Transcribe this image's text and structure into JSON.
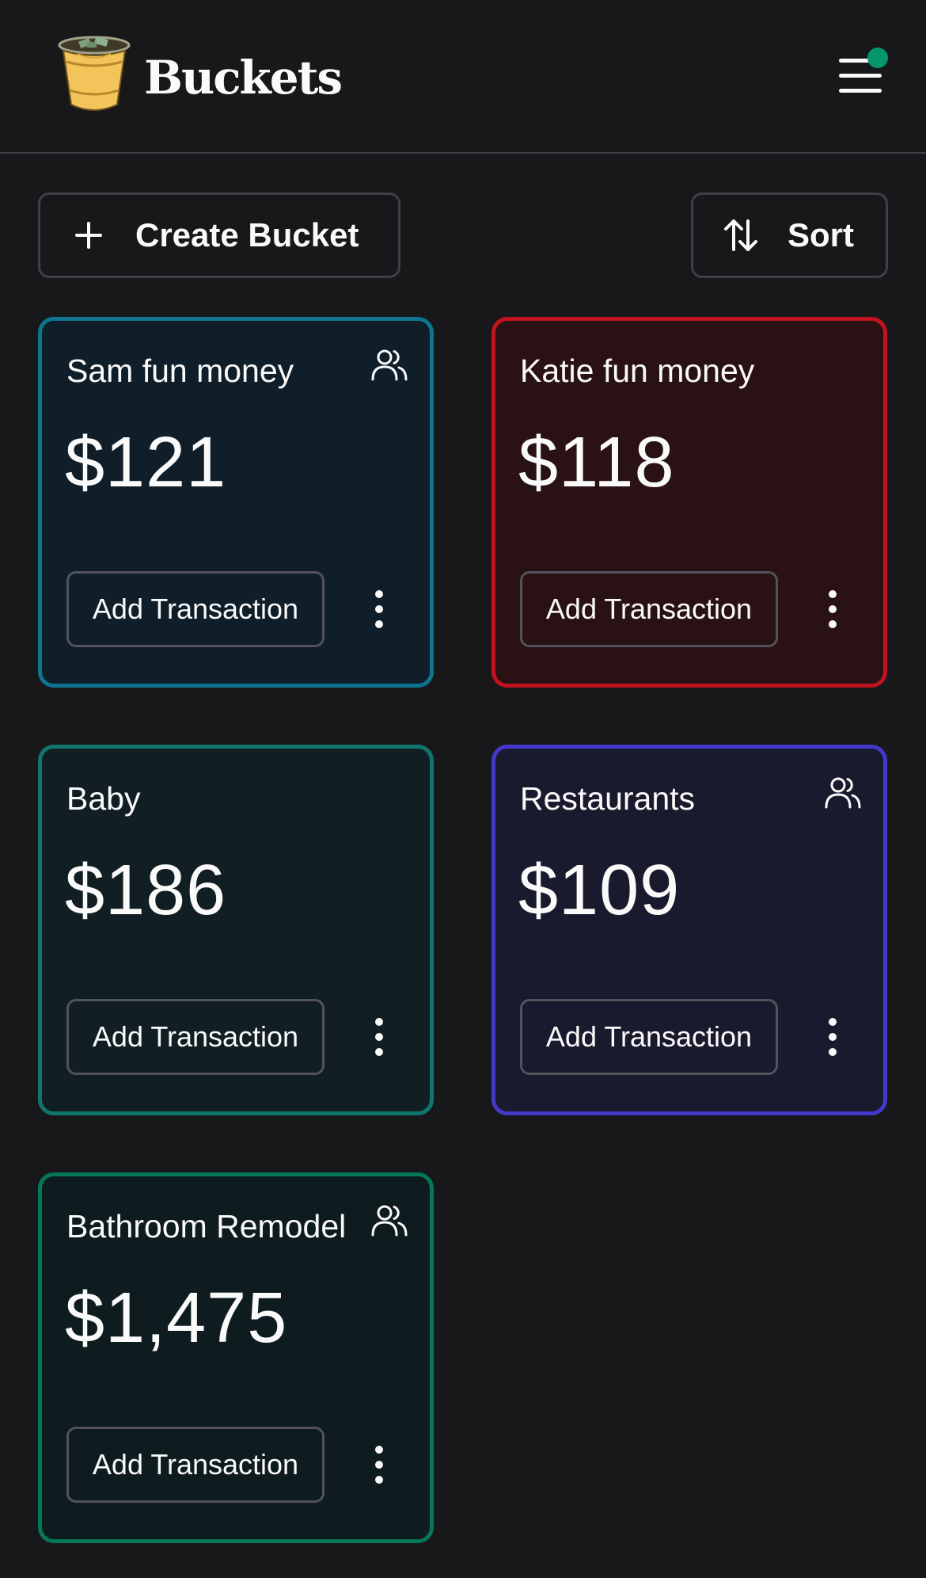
{
  "app": {
    "name": "Buckets",
    "logo_icon": "bucket-logo-icon",
    "menu_icon": "hamburger-menu-icon",
    "notification_color": "#059669"
  },
  "toolbar": {
    "create_label": "Create Bucket",
    "create_icon": "plus-icon",
    "sort_label": "Sort",
    "sort_icon": "sort-arrows-icon"
  },
  "buckets": [
    {
      "name": "Sam fun money",
      "amount": "$121",
      "shared": true,
      "border": "#0e7490",
      "bg": "#0f1e29",
      "action_label": "Add Transaction"
    },
    {
      "name": "Katie fun money",
      "amount": "$118",
      "shared": false,
      "border": "#c1121f",
      "bg": "#2a1214",
      "action_label": "Add Transaction"
    },
    {
      "name": "Baby",
      "amount": "$186",
      "shared": false,
      "border": "#0f766e",
      "bg": "#111f24",
      "action_label": "Add Transaction"
    },
    {
      "name": "Restaurants",
      "amount": "$109",
      "shared": true,
      "border": "#4338ca",
      "bg": "#1a1a2e",
      "action_label": "Add Transaction"
    },
    {
      "name": "Bathroom Remodel",
      "amount": "$1,475",
      "shared": true,
      "border": "#047857",
      "bg": "#0f1c1f",
      "action_label": "Add Transaction"
    }
  ]
}
